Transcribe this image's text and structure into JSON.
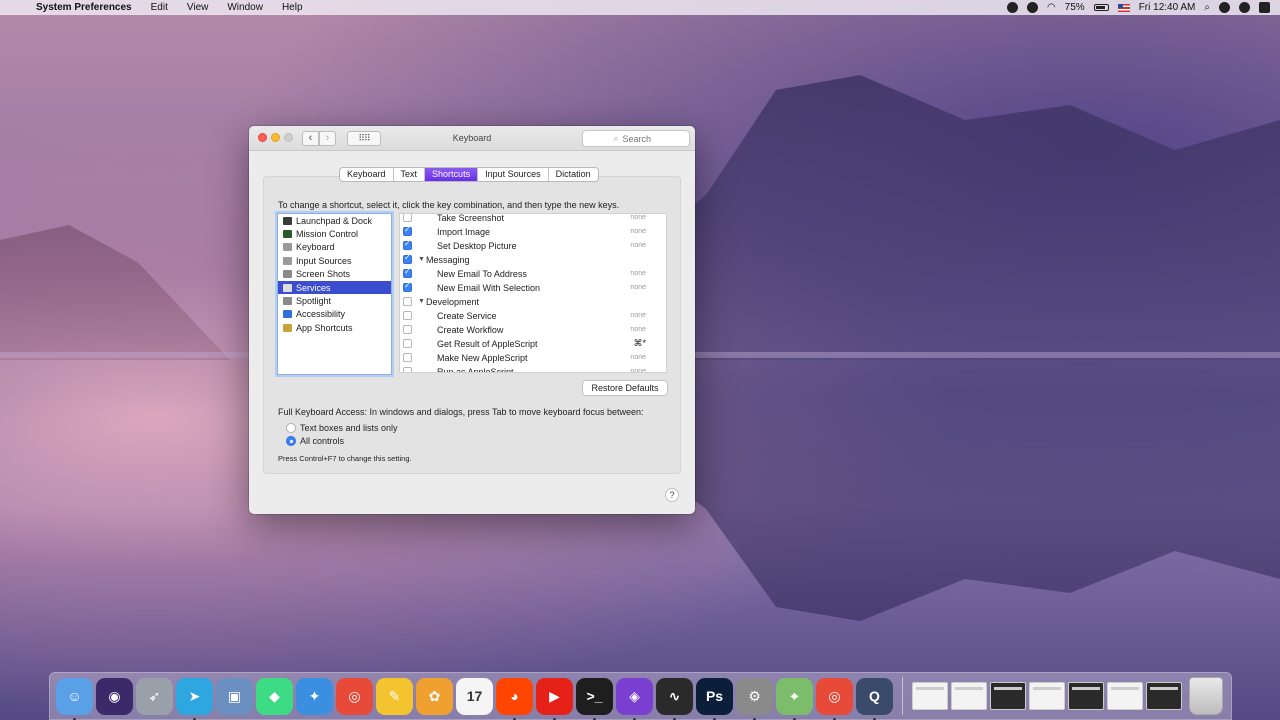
{
  "menubar": {
    "apple": "",
    "app_name": "System Preferences",
    "menus": [
      "Edit",
      "View",
      "Window",
      "Help"
    ],
    "battery": "75%",
    "clock": "Fri 12:40 AM"
  },
  "window": {
    "title": "Keyboard",
    "search_placeholder": "Search",
    "back": "‹",
    "forward": "›",
    "grid": "⠿⠿"
  },
  "tabs": [
    "Keyboard",
    "Text",
    "Shortcuts",
    "Input Sources",
    "Dictation"
  ],
  "active_tab": "Shortcuts",
  "instructions": "To change a shortcut, select it, click the key combination, and then type the new keys.",
  "categories": [
    {
      "label": "Launchpad & Dock",
      "icon": "launchpad-icon",
      "color": "#3a3a3a"
    },
    {
      "label": "Mission Control",
      "icon": "mission-control-icon",
      "color": "#2a5a2a"
    },
    {
      "label": "Keyboard",
      "icon": "keyboard-icon",
      "color": "#9a9a9a"
    },
    {
      "label": "Input Sources",
      "icon": "input-sources-icon",
      "color": "#9a9a9a"
    },
    {
      "label": "Screen Shots",
      "icon": "screenshot-icon",
      "color": "#8a8a8a"
    },
    {
      "label": "Services",
      "icon": "gear-icon",
      "color": "#dddddd"
    },
    {
      "label": "Spotlight",
      "icon": "spotlight-icon",
      "color": "#8a8a8a"
    },
    {
      "label": "Accessibility",
      "icon": "accessibility-icon",
      "color": "#2f6fd6"
    },
    {
      "label": "App Shortcuts",
      "icon": "app-shortcuts-icon",
      "color": "#c8a23a"
    }
  ],
  "selected_category": "Services",
  "services": [
    {
      "label": "Take Screenshot",
      "checked": false,
      "group": false,
      "key": "none"
    },
    {
      "label": "Import Image",
      "checked": true,
      "group": false,
      "key": "none"
    },
    {
      "label": "Set Desktop Picture",
      "checked": true,
      "group": false,
      "key": "none"
    },
    {
      "label": "Messaging",
      "checked": true,
      "group": true,
      "key": ""
    },
    {
      "label": "New Email To Address",
      "checked": true,
      "group": false,
      "key": "none"
    },
    {
      "label": "New Email With Selection",
      "checked": true,
      "group": false,
      "key": "none"
    },
    {
      "label": "Development",
      "checked": false,
      "group": true,
      "key": ""
    },
    {
      "label": "Create Service",
      "checked": false,
      "group": false,
      "key": "none"
    },
    {
      "label": "Create Workflow",
      "checked": false,
      "group": false,
      "key": "none"
    },
    {
      "label": "Get Result of AppleScript",
      "checked": false,
      "group": false,
      "key": "⌘*"
    },
    {
      "label": "Make New AppleScript",
      "checked": false,
      "group": false,
      "key": "none"
    },
    {
      "label": "Run as AppleScript",
      "checked": false,
      "group": false,
      "key": "none"
    }
  ],
  "restore_label": "Restore Defaults",
  "full_keyboard_access": "Full Keyboard Access: In windows and dialogs, press Tab to move keyboard focus between:",
  "radio_options": [
    {
      "label": "Text boxes and lists only",
      "selected": false
    },
    {
      "label": "All controls",
      "selected": true
    }
  ],
  "hint": "Press Control+F7 to change this setting.",
  "help": "?",
  "dock": {
    "apps": [
      {
        "name": "finder",
        "color": "#5aa0e6",
        "glyph": "☺",
        "running": true
      },
      {
        "name": "siri",
        "color": "#3a2a6a",
        "glyph": "◉",
        "running": false
      },
      {
        "name": "launchpad",
        "color": "#9aa0aa",
        "glyph": "➶",
        "running": false
      },
      {
        "name": "telegram",
        "color": "#2ea6df",
        "glyph": "➤",
        "running": true
      },
      {
        "name": "preview",
        "color": "#6a8fc0",
        "glyph": "▣",
        "running": false
      },
      {
        "name": "android-studio",
        "color": "#3ddc84",
        "glyph": "◆",
        "running": false
      },
      {
        "name": "safari",
        "color": "#3b8fe0",
        "glyph": "✦",
        "running": false
      },
      {
        "name": "chrome",
        "color": "#e84a3a",
        "glyph": "◎",
        "running": false
      },
      {
        "name": "idea",
        "color": "#f4c430",
        "glyph": "✎",
        "running": false
      },
      {
        "name": "photos",
        "color": "#f0a030",
        "glyph": "✿",
        "running": false
      },
      {
        "name": "calendar",
        "color": "#f5f5f5",
        "glyph": "17",
        "running": false
      },
      {
        "name": "reddit",
        "color": "#ff4500",
        "glyph": "◕",
        "running": true
      },
      {
        "name": "youtube-music",
        "color": "#e62117",
        "glyph": "▶",
        "running": true
      },
      {
        "name": "terminal",
        "color": "#1e1e1e",
        "glyph": ">_",
        "running": true
      },
      {
        "name": "visual-studio",
        "color": "#7a3fd0",
        "glyph": "◈",
        "running": true
      },
      {
        "name": "activity-monitor",
        "color": "#2a2a2a",
        "glyph": "∿",
        "running": true
      },
      {
        "name": "photoshop",
        "color": "#0c1f3a",
        "glyph": "Ps",
        "running": true
      },
      {
        "name": "system-preferences",
        "color": "#8a8a8a",
        "glyph": "⚙",
        "running": true
      },
      {
        "name": "maps",
        "color": "#7bbd6a",
        "glyph": "⌖",
        "running": true
      },
      {
        "name": "chrome-2",
        "color": "#e84a3a",
        "glyph": "◎",
        "running": true
      },
      {
        "name": "quicktime",
        "color": "#3a4a6a",
        "glyph": "Q",
        "running": true
      }
    ],
    "thumbs": [
      "light",
      "light",
      "dark",
      "light",
      "dark",
      "light",
      "dark"
    ]
  }
}
